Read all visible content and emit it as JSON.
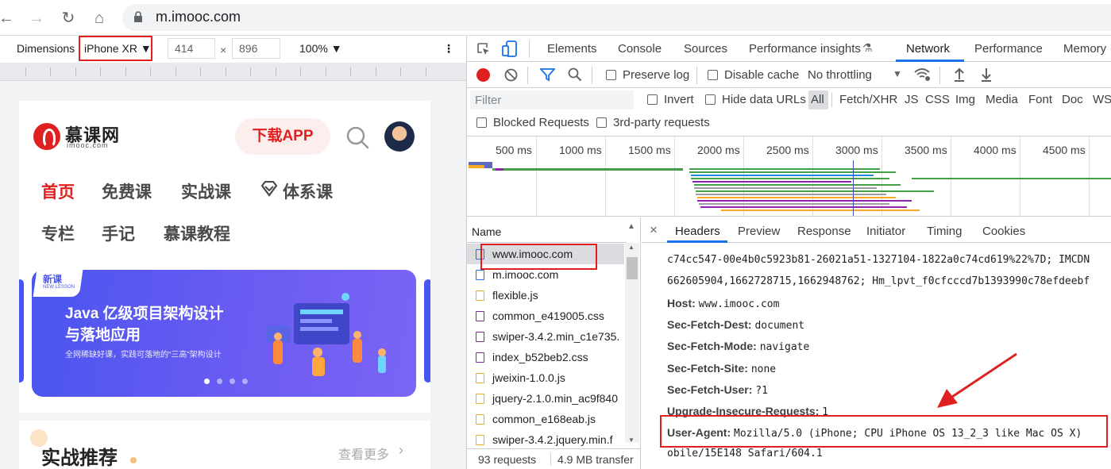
{
  "browser": {
    "url": "m.imooc.com"
  },
  "device_toolbar": {
    "dimensions_label": "Dimensions",
    "device": "iPhone XR ▼",
    "width": "414",
    "times": "×",
    "height": "896",
    "zoom": "100% ▼",
    "more": "⋮"
  },
  "mobile": {
    "logo_text": "慕课网",
    "logo_sub": "imooc.com",
    "download_button": "下载APP",
    "nav": [
      "首页",
      "免费课",
      "实战课",
      "体系课",
      "专栏",
      "手记",
      "慕课教程"
    ],
    "banner": {
      "tag": "新课",
      "tag_sub": "NEW LESSON",
      "title1": "Java 亿级项目架构设计",
      "title2": "与落地应用",
      "subtitle": "全网稀缺好课，实践可落地的“三高”架构设计"
    },
    "section_title": "实战推荐",
    "section_more": "查看更多"
  },
  "devtools": {
    "tabs": [
      "Elements",
      "Console",
      "Sources",
      "Performance insights",
      "Network",
      "Performance",
      "Memory"
    ],
    "active_tab": "Network",
    "toolbar": {
      "preserve_log": "Preserve log",
      "disable_cache": "Disable cache",
      "throttling": "No throttling"
    },
    "filter": {
      "placeholder": "Filter",
      "invert": "Invert",
      "hide_data_urls": "Hide data URLs",
      "types": [
        "All",
        "Fetch/XHR",
        "JS",
        "CSS",
        "Img",
        "Media",
        "Font",
        "Doc",
        "WS"
      ],
      "blocked": "Blocked Requests",
      "third_party": "3rd-party requests"
    },
    "timeline_ticks": [
      "500 ms",
      "1000 ms",
      "1500 ms",
      "2000 ms",
      "2500 ms",
      "3000 ms",
      "3500 ms",
      "4000 ms",
      "4500 ms"
    ],
    "name_header": "Name",
    "requests": [
      {
        "name": "www.imooc.com",
        "type": "doc"
      },
      {
        "name": "m.imooc.com",
        "type": "doc"
      },
      {
        "name": "flexible.js",
        "type": "js"
      },
      {
        "name": "common_e419005.css",
        "type": "css"
      },
      {
        "name": "swiper-3.4.2.min_c1e735.",
        "type": "css"
      },
      {
        "name": "index_b52beb2.css",
        "type": "css"
      },
      {
        "name": "jweixin-1.0.0.js",
        "type": "js"
      },
      {
        "name": "jquery-2.1.0.min_ac9f840",
        "type": "js"
      },
      {
        "name": "common_e168eab.js",
        "type": "js"
      },
      {
        "name": "swiper-3.4.2.jquery.min.f",
        "type": "js"
      }
    ],
    "status": {
      "requests": "93 requests",
      "transfer": "4.9 MB transfer"
    },
    "detail_tabs": [
      "Headers",
      "Preview",
      "Response",
      "Initiator",
      "Timing",
      "Cookies"
    ],
    "close": "×",
    "cookie_line1": "c74cc547-00e4b0c5923b81-26021a51-1327104-1822a0c74cd619%22%7D; IMCDN",
    "cookie_line2": "662605904,1662728715,1662948762; Hm_lpvt_f0cfcccd7b1393990c78efdeebf",
    "headers": [
      {
        "k": "Host:",
        "v": "www.imooc.com"
      },
      {
        "k": "Sec-Fetch-Dest:",
        "v": "document"
      },
      {
        "k": "Sec-Fetch-Mode:",
        "v": "navigate"
      },
      {
        "k": "Sec-Fetch-Site:",
        "v": "none"
      },
      {
        "k": "Sec-Fetch-User:",
        "v": "?1"
      },
      {
        "k": "Upgrade-Insecure-Requests:",
        "v": "1"
      },
      {
        "k": "User-Agent:",
        "v": "Mozilla/5.0 (iPhone; CPU iPhone OS 13_2_3 like Mac OS X)"
      }
    ],
    "ua_cont": "obile/15E148 Safari/604.1"
  },
  "colors": {
    "accent": "#1a73e8",
    "brand_red": "#e02020",
    "annotation_red": "#e02020"
  }
}
